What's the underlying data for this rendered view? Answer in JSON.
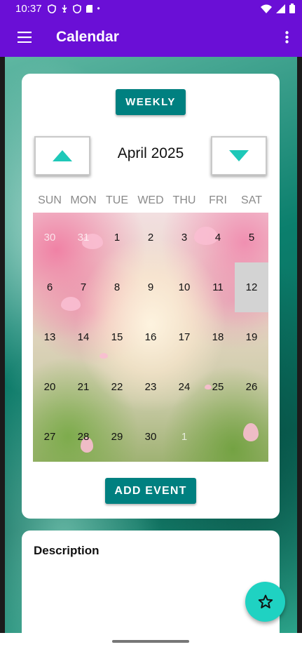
{
  "status_bar": {
    "time": "10:37",
    "dot": "•",
    "icons": [
      "shield-icon",
      "usb-icon",
      "shield-icon",
      "sd-card-icon",
      "wifi-icon",
      "signal-icon",
      "battery-icon"
    ]
  },
  "app_bar": {
    "title": "Calendar",
    "menu_icon": "hamburger-menu-icon",
    "more_icon": "more-vert-icon"
  },
  "calendar": {
    "weekly_label": "WEEKLY",
    "month_label": "April 2025",
    "prev_icon": "arrow-up-icon",
    "next_icon": "arrow-down-icon",
    "day_headers": [
      "SUN",
      "MON",
      "TUE",
      "WED",
      "THU",
      "FRI",
      "SAT"
    ],
    "weeks": [
      [
        "30",
        "31",
        "1",
        "2",
        "3",
        "4",
        "5"
      ],
      [
        "6",
        "7",
        "8",
        "9",
        "10",
        "11",
        "12"
      ],
      [
        "13",
        "14",
        "15",
        "16",
        "17",
        "18",
        "19"
      ],
      [
        "20",
        "21",
        "22",
        "23",
        "24",
        "25",
        "26"
      ],
      [
        "27",
        "28",
        "29",
        "30",
        "1",
        "",
        ""
      ]
    ],
    "today": "12",
    "add_event_label": "ADD EVENT"
  },
  "description": {
    "title": "Description"
  },
  "fab": {
    "icon": "star-outline-icon"
  },
  "colors": {
    "primary": "#6a0fd6",
    "accent": "#008080",
    "fab": "#1fd2c2",
    "arrow": "#1ec8b8",
    "today_bg": "#d3d3d3"
  }
}
